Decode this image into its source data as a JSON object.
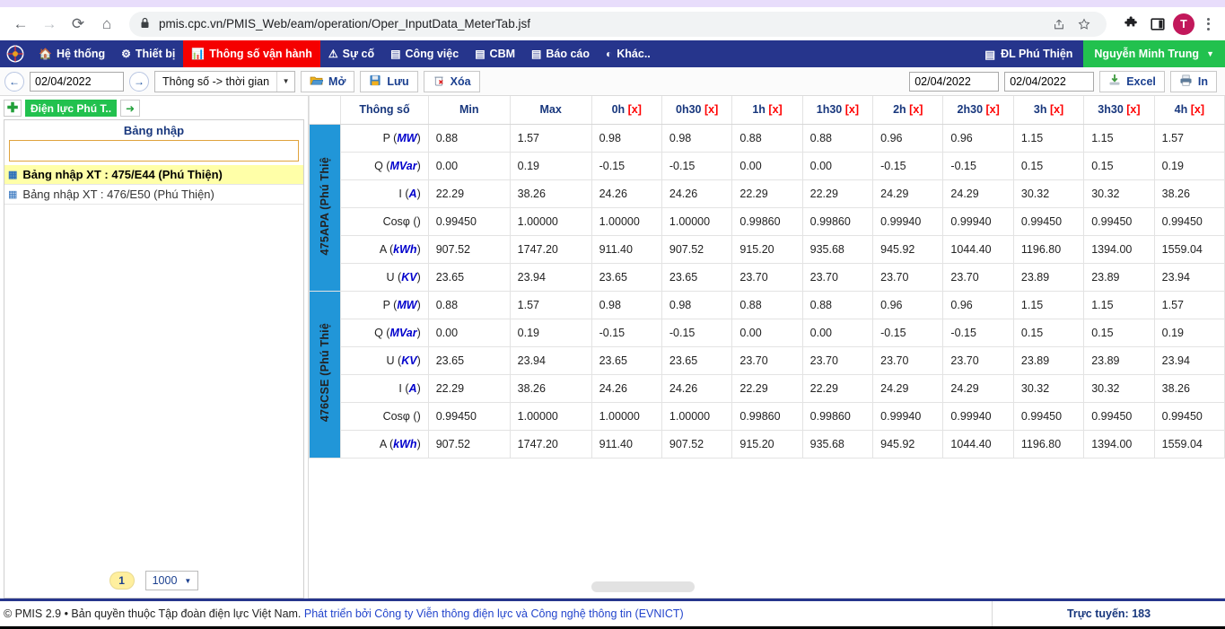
{
  "browser": {
    "url": "pmis.cpc.vn/PMIS_Web/eam/operation/Oper_InputData_MeterTab.jsf",
    "back_icon": "←",
    "forward_icon": "→",
    "reload_icon": "⟳",
    "home_icon": "⌂",
    "lock_icon": "🔒",
    "share_icon": "↗",
    "bookmark_icon": "☆",
    "extensions_icon": "🧩",
    "sidepanel_icon": "▢",
    "avatar_label": "T",
    "menu_icon": "kebab-menu"
  },
  "appnav": {
    "logo_icon": "cpc-logo",
    "items": [
      {
        "label": "Hệ thống",
        "icon": "🏠",
        "active": false
      },
      {
        "label": "Thiết bị",
        "icon": "⚙",
        "active": false
      },
      {
        "label": "Thông số vận hành",
        "icon": "📊",
        "active": true
      },
      {
        "label": "Sự cố",
        "icon": "⚠",
        "active": false
      },
      {
        "label": "Công việc",
        "icon": "▤",
        "active": false
      },
      {
        "label": "CBM",
        "icon": "▤",
        "active": false
      },
      {
        "label": "Báo cáo",
        "icon": "▤",
        "active": false
      },
      {
        "label": "Khác..",
        "icon": "◐",
        "active": false
      }
    ],
    "org_label": "ĐL Phú Thiện",
    "org_icon": "▤",
    "user_label": "Nguyễn Minh Trung",
    "user_caret": "▼"
  },
  "toolbar": {
    "prev_icon": "←",
    "next_icon": "→",
    "date_value": "02/04/2022",
    "mode_select": "Thông số -> thời gian",
    "mode_caret": "▼",
    "open_label": "Mở",
    "open_icon": "📂",
    "save_label": "Lưu",
    "save_icon": "💾",
    "delete_label": "Xóa",
    "delete_icon": "🗑",
    "date_from": "02/04/2022",
    "date_to": "02/04/2022",
    "excel_label": "Excel",
    "excel_icon": "⤓",
    "print_label": "In",
    "print_icon": "🖨"
  },
  "sidebar": {
    "add_icon": "✚",
    "org_tag": "Điện lực Phú T..",
    "go_icon": "➜",
    "panel_title": "Bảng nhập",
    "search_value": "",
    "search_placeholder": "",
    "tree_items": [
      {
        "icon": "▦",
        "label": "Bảng nhập XT : 475/E44 (Phú Thiện)",
        "selected": true
      },
      {
        "icon": "▦",
        "label": "Bảng nhập XT : 476/E50 (Phú Thiện)",
        "selected": false
      }
    ],
    "page_number": "1",
    "rows_per_page": "1000",
    "rows_caret": "▼"
  },
  "table": {
    "headers": {
      "param": "Thông số",
      "min": "Min",
      "max": "Max",
      "times": [
        "0h",
        "0h30",
        "1h",
        "1h30",
        "2h",
        "2h30",
        "3h",
        "3h30",
        "4h"
      ],
      "time_suffix": "[x]"
    },
    "groups": [
      {
        "name": "475APA (Phú Thiệ",
        "rows": [
          {
            "param": "P",
            "unit": "MW",
            "min": "0.88",
            "max": "1.57",
            "values": [
              "0.98",
              "0.98",
              "0.88",
              "0.88",
              "0.96",
              "0.96",
              "1.15",
              "1.15",
              "1.57"
            ]
          },
          {
            "param": "Q",
            "unit": "MVar",
            "min": "0.00",
            "max": "0.19",
            "values": [
              "-0.15",
              "-0.15",
              "0.00",
              "0.00",
              "-0.15",
              "-0.15",
              "0.15",
              "0.15",
              "0.19"
            ]
          },
          {
            "param": "I",
            "unit": "A",
            "min": "22.29",
            "max": "38.26",
            "values": [
              "24.26",
              "24.26",
              "22.29",
              "22.29",
              "24.29",
              "24.29",
              "30.32",
              "30.32",
              "38.26"
            ]
          },
          {
            "param": "Cosφ",
            "unit": "",
            "min": "0.99450",
            "max": "1.00000",
            "values": [
              "1.00000",
              "1.00000",
              "0.99860",
              "0.99860",
              "0.99940",
              "0.99940",
              "0.99450",
              "0.99450",
              "0.99450"
            ]
          },
          {
            "param": "A",
            "unit": "kWh",
            "min": "907.52",
            "max": "1747.20",
            "values": [
              "911.40",
              "907.52",
              "915.20",
              "935.68",
              "945.92",
              "1044.40",
              "1196.80",
              "1394.00",
              "1559.04"
            ]
          },
          {
            "param": "U",
            "unit": "KV",
            "min": "23.65",
            "max": "23.94",
            "values": [
              "23.65",
              "23.65",
              "23.70",
              "23.70",
              "23.70",
              "23.70",
              "23.89",
              "23.89",
              "23.94"
            ]
          }
        ]
      },
      {
        "name": "476CSE (Phú Thiệ",
        "rows": [
          {
            "param": "P",
            "unit": "MW",
            "min": "0.88",
            "max": "1.57",
            "values": [
              "0.98",
              "0.98",
              "0.88",
              "0.88",
              "0.96",
              "0.96",
              "1.15",
              "1.15",
              "1.57"
            ]
          },
          {
            "param": "Q",
            "unit": "MVar",
            "min": "0.00",
            "max": "0.19",
            "values": [
              "-0.15",
              "-0.15",
              "0.00",
              "0.00",
              "-0.15",
              "-0.15",
              "0.15",
              "0.15",
              "0.19"
            ]
          },
          {
            "param": "U",
            "unit": "KV",
            "min": "23.65",
            "max": "23.94",
            "values": [
              "23.65",
              "23.65",
              "23.70",
              "23.70",
              "23.70",
              "23.70",
              "23.89",
              "23.89",
              "23.94"
            ]
          },
          {
            "param": "I",
            "unit": "A",
            "min": "22.29",
            "max": "38.26",
            "values": [
              "24.26",
              "24.26",
              "22.29",
              "22.29",
              "24.29",
              "24.29",
              "30.32",
              "30.32",
              "38.26"
            ]
          },
          {
            "param": "Cosφ",
            "unit": "",
            "min": "0.99450",
            "max": "1.00000",
            "values": [
              "1.00000",
              "1.00000",
              "0.99860",
              "0.99860",
              "0.99940",
              "0.99940",
              "0.99450",
              "0.99450",
              "0.99450"
            ]
          },
          {
            "param": "A",
            "unit": "kWh",
            "min": "907.52",
            "max": "1747.20",
            "values": [
              "911.40",
              "907.52",
              "915.20",
              "935.68",
              "945.92",
              "1044.40",
              "1196.80",
              "1394.00",
              "1559.04"
            ]
          }
        ]
      }
    ]
  },
  "footer": {
    "text": "© PMIS 2.9 • Bản quyền thuộc Tập đoàn điện lực Việt Nam.",
    "link": "Phát triển bởi Công ty Viễn thông điện lực và Công nghệ thông tin (EVNICT)",
    "online": "Trực tuyến: 183"
  }
}
